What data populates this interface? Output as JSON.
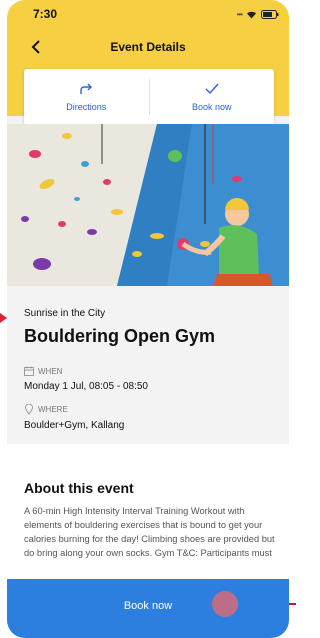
{
  "status_bar": {
    "time": "7:30"
  },
  "header": {
    "title": "Event Details"
  },
  "actions": [
    {
      "label": "Directions",
      "icon": "directions-icon"
    },
    {
      "label": "Book now",
      "icon": "checkmark-icon"
    }
  ],
  "event": {
    "host": "Sunrise in the City",
    "title": "Bouldering Open Gym",
    "when_label": "WHEN",
    "when_value": "Monday 1 Jul, 08:05 - 08:50",
    "where_label": "WHERE",
    "where_value": "Boulder+Gym, Kallang"
  },
  "about": {
    "title": "About this event",
    "text": "A 60-min High Intensity Interval Training Workout with elements of bouldering exercises that is bound to get your calories burning for the day! Climbing shoes are provided but do bring along your own socks. Gym T&C: Participants must"
  },
  "footer": {
    "book_label": "Book now"
  },
  "colors": {
    "header": "#f6cf43",
    "accent": "#2d7fdf",
    "link": "#2a64d6"
  }
}
